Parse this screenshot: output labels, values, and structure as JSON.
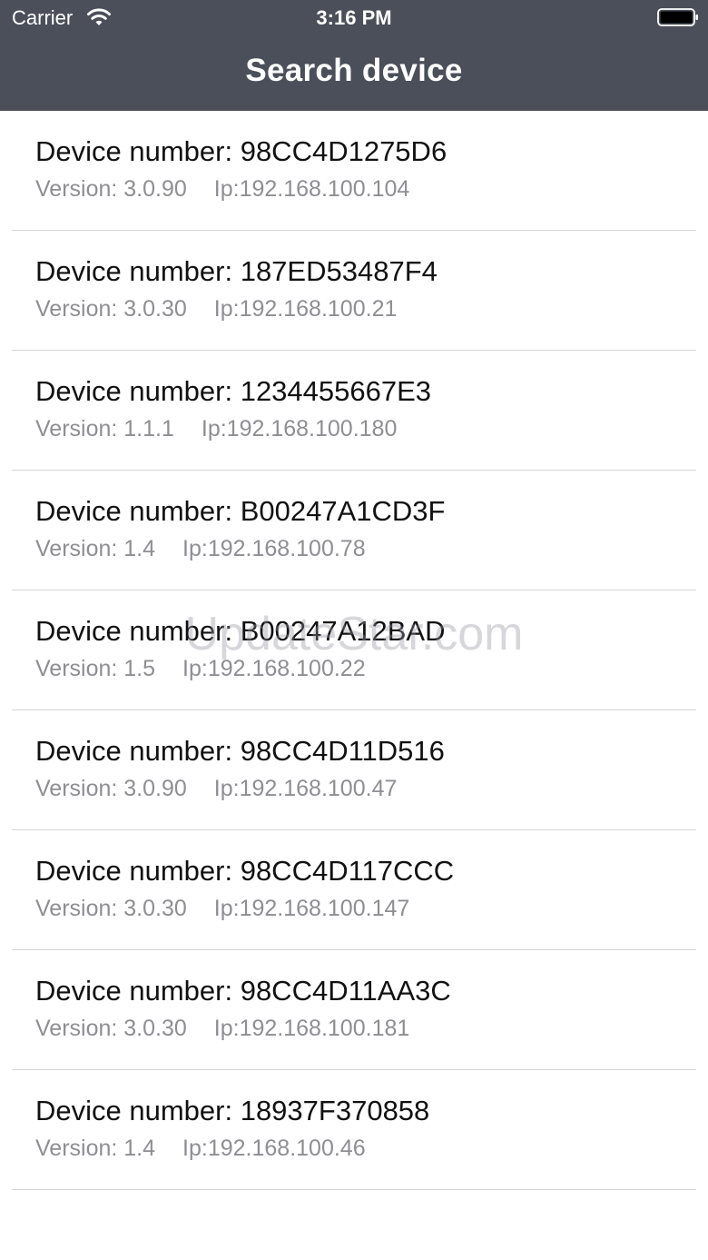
{
  "status_bar": {
    "carrier": "Carrier",
    "time": "3:16 PM",
    "wifi_icon": "wifi-icon",
    "battery_icon": "battery-icon"
  },
  "nav": {
    "title": "Search device"
  },
  "colors": {
    "header_bg": "#4a4f5a",
    "primary_text": "#111111",
    "secondary_text": "#8e8e93",
    "separator": "#d6d6d8"
  },
  "devices": [
    {
      "number": "Device number: 98CC4D1275D6",
      "version": "Version: 3.0.90",
      "ip": "Ip:192.168.100.104"
    },
    {
      "number": "Device number: 187ED53487F4",
      "version": "Version: 3.0.30",
      "ip": "Ip:192.168.100.21"
    },
    {
      "number": "Device number: 1234455667E3",
      "version": "Version: 1.1.1",
      "ip": "Ip:192.168.100.180"
    },
    {
      "number": "Device number: B00247A1CD3F",
      "version": "Version: 1.4",
      "ip": "Ip:192.168.100.78"
    },
    {
      "number": "Device number: B00247A12BAD",
      "version": "Version: 1.5",
      "ip": "Ip:192.168.100.22"
    },
    {
      "number": "Device number: 98CC4D11D516",
      "version": "Version: 3.0.90",
      "ip": "Ip:192.168.100.47"
    },
    {
      "number": "Device number: 98CC4D117CCC",
      "version": "Version: 3.0.30",
      "ip": "Ip:192.168.100.147"
    },
    {
      "number": "Device number: 98CC4D11AA3C",
      "version": "Version: 3.0.30",
      "ip": "Ip:192.168.100.181"
    },
    {
      "number": "Device number: 18937F370858",
      "version": "Version: 1.4",
      "ip": "Ip:192.168.100.46"
    }
  ],
  "watermark": "UpdateStar.com"
}
